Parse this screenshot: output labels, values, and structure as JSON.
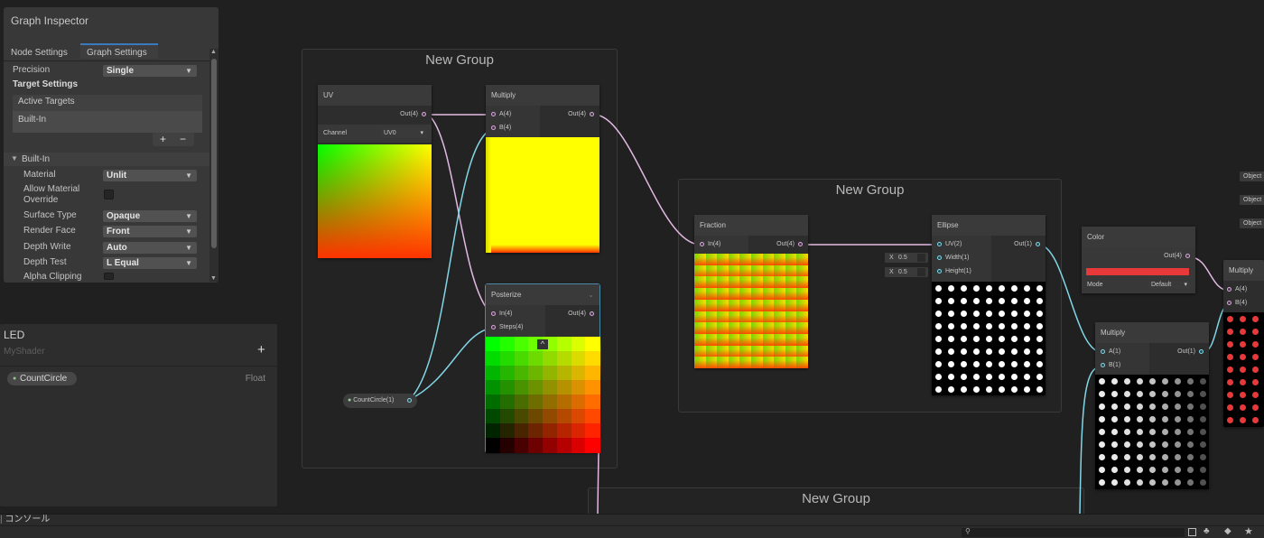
{
  "inspector": {
    "title": "Graph Inspector",
    "tabs": [
      "Node Settings",
      "Graph Settings"
    ],
    "precision_label": "Precision",
    "precision_value": "Single",
    "target_settings": "Target Settings",
    "active_targets": "Active Targets",
    "target_item": "Built-In",
    "add": "+",
    "remove": "−",
    "builtin_section": "Built-In",
    "rows": {
      "material": {
        "label": "Material",
        "value": "Unlit"
      },
      "allow_override": {
        "label1": "Allow Material",
        "label2": "Override"
      },
      "surface": {
        "label": "Surface Type",
        "value": "Opaque"
      },
      "render_face": {
        "label": "Render Face",
        "value": "Front"
      },
      "depth_write": {
        "label": "Depth Write",
        "value": "Auto"
      },
      "depth_test": {
        "label": "Depth Test",
        "value": "L Equal"
      },
      "alpha_clip": {
        "label": "Alpha Clipping"
      }
    }
  },
  "blackboard": {
    "title": "LED",
    "subtitle": "MyShader",
    "add": "+",
    "property": {
      "name": "CountCircle",
      "type": "Float"
    }
  },
  "groups": {
    "g1": "New Group",
    "g2": "New Group",
    "g3": "New Group"
  },
  "nodes": {
    "uv": {
      "title": "UV",
      "out": "Out(4)",
      "channel_label": "Channel",
      "channel_value": "UV0"
    },
    "multiply1": {
      "title": "Multiply",
      "a": "A(4)",
      "b": "B(4)",
      "out": "Out(4)"
    },
    "posterize": {
      "title": "Posterize",
      "in": "In(4)",
      "steps": "Steps(4)",
      "out": "Out(4)"
    },
    "fraction": {
      "title": "Fraction",
      "in": "In(4)",
      "out": "Out(4)"
    },
    "ellipse": {
      "title": "Ellipse",
      "uv": "UV(2)",
      "width": "Width(1)",
      "height": "Height(1)",
      "out": "Out(1)",
      "width_x": "X",
      "width_val": "0.5",
      "height_x": "X",
      "height_val": "0.5"
    },
    "color": {
      "title": "Color",
      "out": "Out(4)",
      "mode_label": "Mode",
      "mode_value": "Default"
    },
    "multiply2": {
      "title": "Multiply",
      "a": "A(1)",
      "b": "B(1)",
      "out": "Out(1)"
    },
    "multiply3": {
      "title": "Multiply",
      "a": "A(4)",
      "b": "B(4)"
    },
    "countcircle": {
      "label": "CountCircle(1)"
    }
  },
  "right_labels": [
    "Object",
    "Object",
    "Object"
  ],
  "console": {
    "label": "コンソール"
  },
  "colors": {
    "accent": "#3a79bb",
    "wire_pink": "#e3b9e3",
    "wire_cyan": "#82d6e6",
    "color_swatch": "#e8393a"
  }
}
